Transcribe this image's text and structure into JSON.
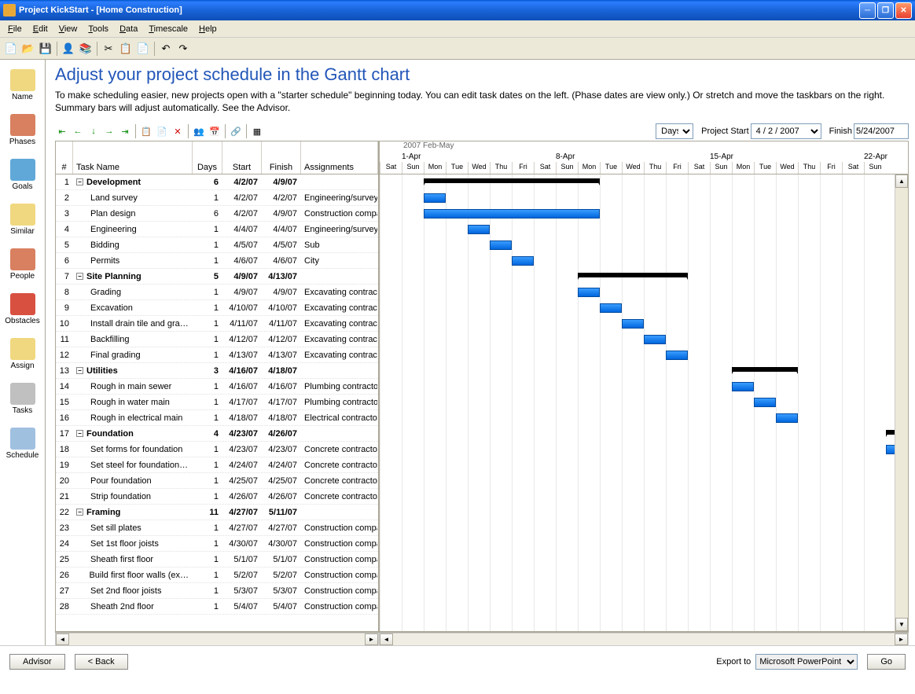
{
  "window": {
    "title": "Project KickStart - [Home Construction]"
  },
  "menu": [
    "File",
    "Edit",
    "View",
    "Tools",
    "Data",
    "Timescale",
    "Help"
  ],
  "sidebar": [
    {
      "label": "Name",
      "color": "#f0d880"
    },
    {
      "label": "Phases",
      "color": "#d88060"
    },
    {
      "label": "Goals",
      "color": "#60a8d8"
    },
    {
      "label": "Similar",
      "color": "#f0d880"
    },
    {
      "label": "People",
      "color": "#d88060"
    },
    {
      "label": "Obstacles",
      "color": "#d85040"
    },
    {
      "label": "Assign",
      "color": "#f0d880"
    },
    {
      "label": "Tasks",
      "color": "#c0c0c0"
    },
    {
      "label": "Schedule",
      "color": "#a0c0e0"
    }
  ],
  "page": {
    "title": "Adjust your project schedule in the Gantt chart",
    "desc": "To make scheduling easier, new projects open with a \"starter schedule\" beginning today. You can edit task dates on the left. (Phase dates are view only.) Or stretch and move the taskbars on the right. Summary bars will adjust automatically. See the Advisor."
  },
  "controls": {
    "timescale": "Days",
    "project_start_label": "Project Start",
    "project_start": "4 / 2 / 2007",
    "finish_label": "Finish",
    "finish": "5/24/2007"
  },
  "columns": {
    "num": "#",
    "name": "Task Name",
    "days": "Days",
    "start": "Start",
    "finish": "Finish",
    "assign": "Assignments"
  },
  "timeline": {
    "month_label": "2007 Feb-May",
    "day_width": 28,
    "first_day_offset": 0,
    "weeks": [
      {
        "label": "",
        "col": 0
      },
      {
        "label": "1-Apr",
        "col": 1
      },
      {
        "label": "8-Apr",
        "col": 8
      },
      {
        "label": "15-Apr",
        "col": 15
      },
      {
        "label": "22-Apr",
        "col": 22
      }
    ],
    "days": [
      "Sat",
      "Sun",
      "Mon",
      "Tue",
      "Wed",
      "Thu",
      "Fri",
      "Sat",
      "Sun",
      "Mon",
      "Tue",
      "Wed",
      "Thu",
      "Fri",
      "Sat",
      "Sun",
      "Mon",
      "Tue",
      "Wed",
      "Thu",
      "Fri",
      "Sat",
      "Sun"
    ]
  },
  "tasks": [
    {
      "n": 1,
      "name": "Development",
      "days": 6,
      "start": "4/2/07",
      "finish": "4/9/07",
      "assign": "",
      "phase": true,
      "bar": [
        2,
        9
      ]
    },
    {
      "n": 2,
      "name": "Land survey",
      "days": 1,
      "start": "4/2/07",
      "finish": "4/2/07",
      "assign": "Engineering/surveyors",
      "indent": 1,
      "bar": [
        2,
        2
      ]
    },
    {
      "n": 3,
      "name": "Plan design",
      "days": 6,
      "start": "4/2/07",
      "finish": "4/9/07",
      "assign": "Construction company",
      "indent": 1,
      "bar": [
        2,
        9
      ]
    },
    {
      "n": 4,
      "name": "Engineering",
      "days": 1,
      "start": "4/4/07",
      "finish": "4/4/07",
      "assign": "Engineering/surveyors",
      "indent": 1,
      "bar": [
        4,
        4
      ]
    },
    {
      "n": 5,
      "name": "Bidding",
      "days": 1,
      "start": "4/5/07",
      "finish": "4/5/07",
      "assign": "Sub",
      "indent": 1,
      "bar": [
        5,
        5
      ]
    },
    {
      "n": 6,
      "name": "Permits",
      "days": 1,
      "start": "4/6/07",
      "finish": "4/6/07",
      "assign": "City",
      "indent": 1,
      "bar": [
        6,
        6
      ]
    },
    {
      "n": 7,
      "name": "Site Planning",
      "days": 5,
      "start": "4/9/07",
      "finish": "4/13/07",
      "assign": "",
      "phase": true,
      "bar": [
        9,
        13
      ]
    },
    {
      "n": 8,
      "name": "Grading",
      "days": 1,
      "start": "4/9/07",
      "finish": "4/9/07",
      "assign": "Excavating contractor",
      "indent": 1,
      "bar": [
        9,
        9
      ]
    },
    {
      "n": 9,
      "name": "Excavation",
      "days": 1,
      "start": "4/10/07",
      "finish": "4/10/07",
      "assign": "Excavating contractor",
      "indent": 1,
      "bar": [
        10,
        10
      ]
    },
    {
      "n": 10,
      "name": "Install drain tile and gra…",
      "days": 1,
      "start": "4/11/07",
      "finish": "4/11/07",
      "assign": "Excavating contractor",
      "indent": 1,
      "bar": [
        11,
        11
      ]
    },
    {
      "n": 11,
      "name": "Backfilling",
      "days": 1,
      "start": "4/12/07",
      "finish": "4/12/07",
      "assign": "Excavating contractor",
      "indent": 1,
      "bar": [
        12,
        12
      ]
    },
    {
      "n": 12,
      "name": "Final grading",
      "days": 1,
      "start": "4/13/07",
      "finish": "4/13/07",
      "assign": "Excavating contractor",
      "indent": 1,
      "bar": [
        13,
        13
      ]
    },
    {
      "n": 13,
      "name": "Utilities",
      "days": 3,
      "start": "4/16/07",
      "finish": "4/18/07",
      "assign": "",
      "phase": true,
      "bar": [
        16,
        18
      ]
    },
    {
      "n": 14,
      "name": "Rough in main sewer",
      "days": 1,
      "start": "4/16/07",
      "finish": "4/16/07",
      "assign": "Plumbing contractor",
      "indent": 1,
      "bar": [
        16,
        16
      ]
    },
    {
      "n": 15,
      "name": "Rough in water main",
      "days": 1,
      "start": "4/17/07",
      "finish": "4/17/07",
      "assign": "Plumbing contractor",
      "indent": 1,
      "bar": [
        17,
        17
      ]
    },
    {
      "n": 16,
      "name": "Rough in electrical main",
      "days": 1,
      "start": "4/18/07",
      "finish": "4/18/07",
      "assign": "Electrical contractor",
      "indent": 1,
      "bar": [
        18,
        18
      ]
    },
    {
      "n": 17,
      "name": "Foundation",
      "days": 4,
      "start": "4/23/07",
      "finish": "4/26/07",
      "assign": "",
      "phase": true,
      "bar": [
        23,
        26
      ]
    },
    {
      "n": 18,
      "name": "Set forms for foundation",
      "days": 1,
      "start": "4/23/07",
      "finish": "4/23/07",
      "assign": "Concrete contractor",
      "indent": 1,
      "bar": [
        23,
        23
      ]
    },
    {
      "n": 19,
      "name": "Set steel for foundation…",
      "days": 1,
      "start": "4/24/07",
      "finish": "4/24/07",
      "assign": "Concrete contractor",
      "indent": 1,
      "bar": [
        24,
        24
      ]
    },
    {
      "n": 20,
      "name": "Pour foundation",
      "days": 1,
      "start": "4/25/07",
      "finish": "4/25/07",
      "assign": "Concrete contractor",
      "indent": 1,
      "bar": [
        25,
        25
      ]
    },
    {
      "n": 21,
      "name": "Strip foundation",
      "days": 1,
      "start": "4/26/07",
      "finish": "4/26/07",
      "assign": "Concrete contractor",
      "indent": 1,
      "bar": [
        26,
        26
      ]
    },
    {
      "n": 22,
      "name": "Framing",
      "days": 11,
      "start": "4/27/07",
      "finish": "5/11/07",
      "assign": "",
      "phase": true,
      "bar": [
        27,
        41
      ]
    },
    {
      "n": 23,
      "name": "Set sill plates",
      "days": 1,
      "start": "4/27/07",
      "finish": "4/27/07",
      "assign": "Construction company",
      "indent": 1,
      "bar": [
        27,
        27
      ]
    },
    {
      "n": 24,
      "name": "Set 1st floor joists",
      "days": 1,
      "start": "4/30/07",
      "finish": "4/30/07",
      "assign": "Construction company",
      "indent": 1,
      "bar": [
        30,
        30
      ]
    },
    {
      "n": 25,
      "name": "Sheath first floor",
      "days": 1,
      "start": "5/1/07",
      "finish": "5/1/07",
      "assign": "Construction company",
      "indent": 1,
      "bar": [
        31,
        31
      ]
    },
    {
      "n": 26,
      "name": "Build first floor walls (ex…",
      "days": 1,
      "start": "5/2/07",
      "finish": "5/2/07",
      "assign": "Construction company",
      "indent": 1,
      "bar": [
        32,
        32
      ]
    },
    {
      "n": 27,
      "name": "Set 2nd floor joists",
      "days": 1,
      "start": "5/3/07",
      "finish": "5/3/07",
      "assign": "Construction company",
      "indent": 1,
      "bar": [
        33,
        33
      ]
    },
    {
      "n": 28,
      "name": "Sheath 2nd floor",
      "days": 1,
      "start": "5/4/07",
      "finish": "5/4/07",
      "assign": "Construction company",
      "indent": 1,
      "bar": [
        34,
        34
      ]
    }
  ],
  "footer": {
    "advisor": "Advisor",
    "back": "< Back",
    "export_label": "Export to",
    "export_value": "Microsoft PowerPoint",
    "go": "Go"
  }
}
